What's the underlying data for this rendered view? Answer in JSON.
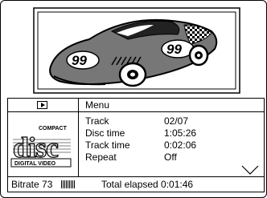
{
  "menu": {
    "title": "Menu"
  },
  "disc_logo": {
    "line1": "COMPACT",
    "big": "disc",
    "line2": "DIGITAL VIDEO"
  },
  "info_rows": [
    {
      "label": "Track",
      "value": "02/07"
    },
    {
      "label": "Disc time",
      "value": "1:05:26"
    },
    {
      "label": "Track time",
      "value": "0:02:06"
    },
    {
      "label": "Repeat",
      "value": "Off"
    }
  ],
  "status": {
    "bitrate_label": "Bitrate 73",
    "bitrate_level_bars": 9,
    "total_elapsed": "Total elapsed 0:01:46"
  },
  "icons": {
    "play": "play-icon",
    "scroll_down": "chevron-down-icon",
    "logo": "compact-disc-logo"
  },
  "preview": {
    "car_number": "99"
  }
}
